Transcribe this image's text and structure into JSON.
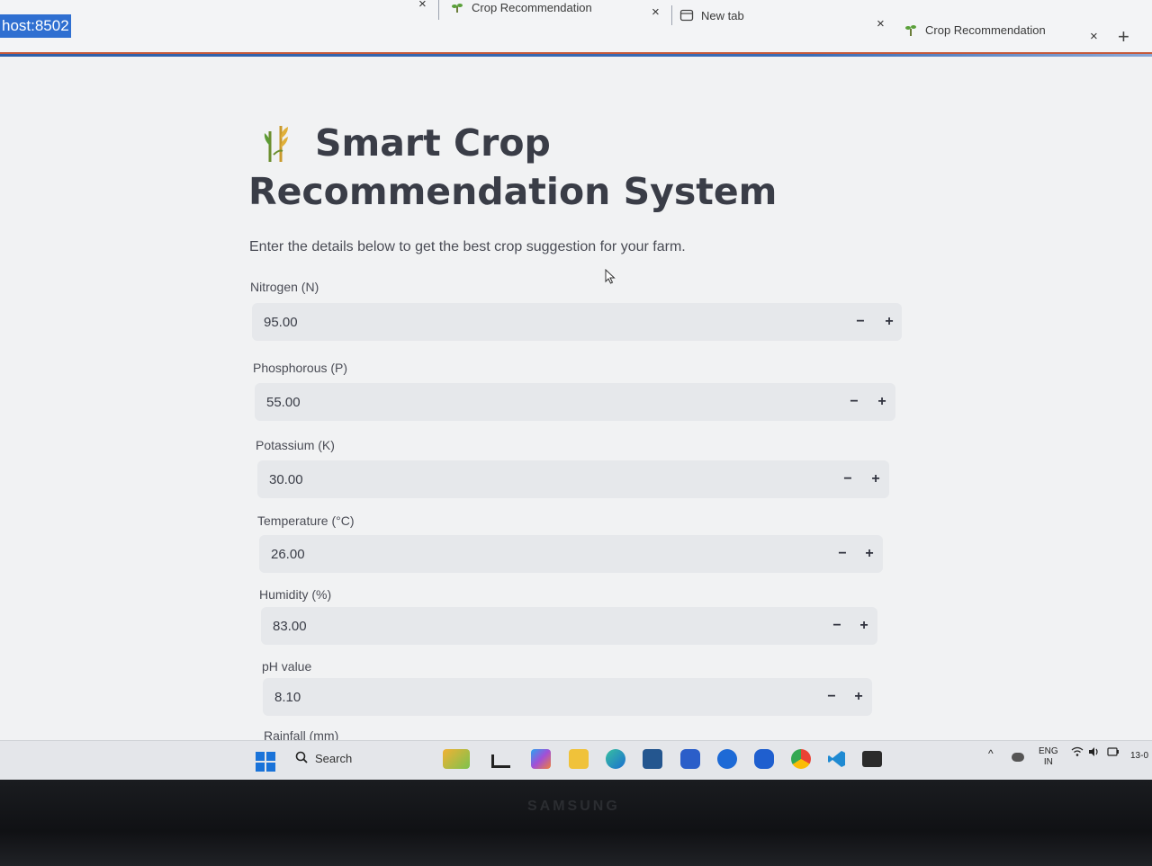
{
  "browser": {
    "address_fragment": "host:8502",
    "tabs": [
      {
        "title": "Crop Recommendation"
      },
      {
        "title": "New tab"
      },
      {
        "title": "Crop Recommendation"
      }
    ],
    "close_symbol": "×",
    "new_tab_symbol": "+"
  },
  "app": {
    "title": "Smart Crop Recommendation System",
    "subtitle": "Enter the details below to get the best crop suggestion for your farm.",
    "fields": [
      {
        "label": "Nitrogen (N)",
        "value": "95.00"
      },
      {
        "label": "Phosphorous (P)",
        "value": "55.00"
      },
      {
        "label": "Potassium (K)",
        "value": "30.00"
      },
      {
        "label": "Temperature (°C)",
        "value": "26.00"
      },
      {
        "label": "Humidity (%)",
        "value": "83.00"
      },
      {
        "label": "pH value",
        "value": "8.10"
      },
      {
        "label": "Rainfall (mm)",
        "value": ""
      }
    ],
    "decrement_symbol": "−",
    "increment_symbol": "+"
  },
  "taskbar": {
    "search_label": "Search",
    "lang_line1": "ENG",
    "lang_line2": "IN",
    "clock_fragment": "13-0"
  },
  "device": {
    "brand": "SAMSUNG"
  },
  "colors": {
    "accent_address": "#2f6fd1",
    "input_bg": "#e6e8eb",
    "page_bg": "#f1f2f3"
  }
}
